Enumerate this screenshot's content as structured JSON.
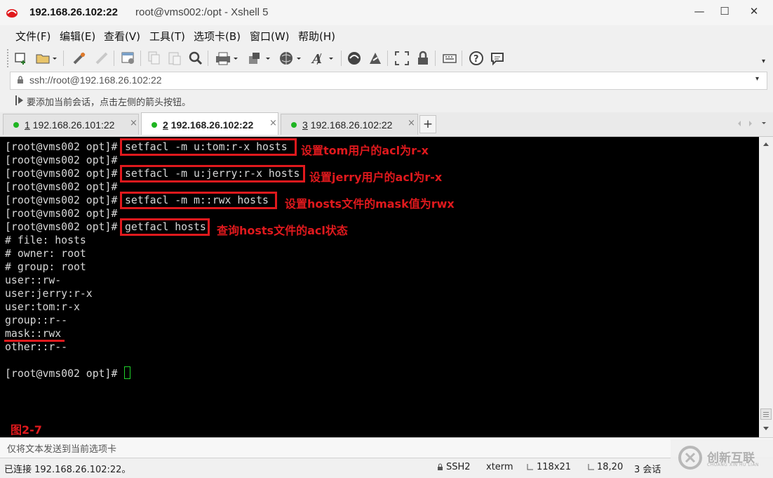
{
  "window": {
    "title_host": "192.168.26.102:22",
    "title_rest": "root@vms002:/opt - Xshell 5",
    "minimize_glyph": "—",
    "maximize_glyph": "☐",
    "close_glyph": "✕"
  },
  "menu": [
    "文件(F)",
    "编辑(E)",
    "查看(V)",
    "工具(T)",
    "选项卡(B)",
    "窗口(W)",
    "帮助(H)"
  ],
  "address": {
    "text": "ssh://root@192.168.26.102:22",
    "dropdown_glyph": "▾"
  },
  "hint": {
    "text": "要添加当前会话，点击左侧的箭头按钮。"
  },
  "tabs": [
    {
      "num": "1",
      "label": " 192.168.26.101:22",
      "active": false
    },
    {
      "num": "2",
      "label": " 192.168.26.102:22",
      "active": true
    },
    {
      "num": "3",
      "label": " 192.168.26.102:22",
      "active": false
    }
  ],
  "tab_close_glyph": "×",
  "tab_add_glyph": "+",
  "terminal": {
    "prompt": "[root@vms002 opt]# ",
    "lines": [
      "[root@vms002 opt]#",
      "[root@vms002 opt]#",
      "[root@vms002 opt]#",
      "[root@vms002 opt]#",
      "[root@vms002 opt]#",
      "[root@vms002 opt]#",
      "[root@vms002 opt]#",
      "# file: hosts",
      "# owner: root",
      "# group: root",
      "user::rw-",
      "user:jerry:r-x",
      "user:tom:r-x",
      "group::r--",
      "mask::rwx",
      "other::r--",
      "",
      "[root@vms002 opt]#"
    ],
    "commands": [
      "setfacl -m u:tom:r-x hosts",
      "setfacl -m u:jerry:r-x hosts",
      "setfacl -m m::rwx hosts",
      "getfacl hosts"
    ],
    "annotations": [
      "设置tom用户的acl为r-x",
      "设置jerry用户的acl为r-x",
      "设置hosts文件的mask值为rwx",
      "查询hosts文件的acl状态"
    ],
    "figure_label": "图2-7",
    "accent_color": "#e0191d",
    "cursor_color": "#1fd12a"
  },
  "sendbar": {
    "text": "仅将文本发送到当前选项卡"
  },
  "status": {
    "connected": "已连接 192.168.26.102:22。",
    "protocol": "SSH2",
    "term": "xterm",
    "size": "118x21",
    "pos": "18,20",
    "sessions": "3 会话"
  },
  "watermark": {
    "cn": "创新互联",
    "en": "CHUANG XIN HU LIAN"
  },
  "icons": [
    "new-session-icon",
    "open-folder-icon",
    "reconnect-icon",
    "disconnect-icon",
    "properties-icon",
    "copy-icon",
    "paste-icon",
    "find-icon",
    "print-icon",
    "transfer-icon",
    "globe-icon",
    "font-icon",
    "xftp-icon",
    "xmanager-icon",
    "fullscreen-icon",
    "lock-icon",
    "keyboard-icon",
    "help-icon",
    "chat-icon"
  ]
}
